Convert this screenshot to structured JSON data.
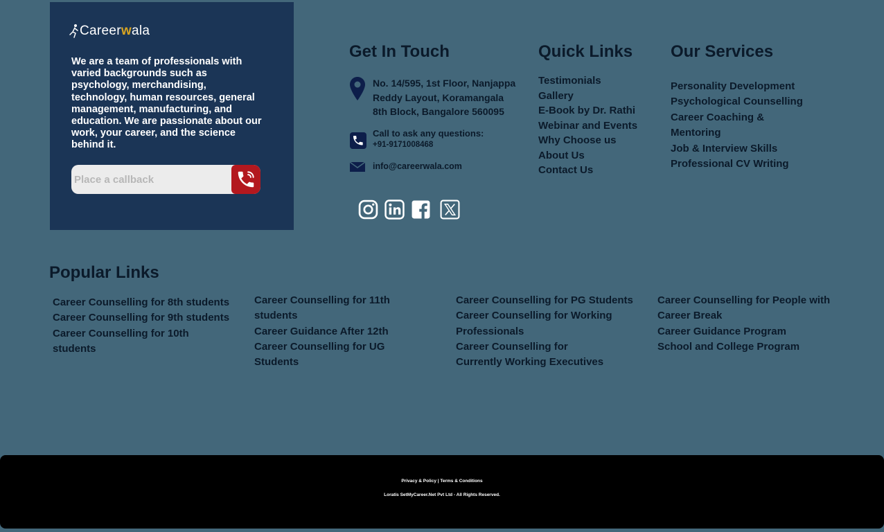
{
  "brand": {
    "logo_main": "Career",
    "logo_w": "w",
    "logo_rest": "ala",
    "accent_color": "#d9a521"
  },
  "about": {
    "text": "We are a team of professionals with varied backgrounds such as psychology, merchandising, technology, human resources, general management, manufacturing, and education. We are passionate about our work, your career, and the science behind it."
  },
  "callback": {
    "placeholder": "Place a callback",
    "button_icon": "phone-icon",
    "button_color": "#b3181e"
  },
  "contact": {
    "heading": "Get In Touch",
    "address": "No. 14/595, 1st Floor, Nanjappa Reddy Layout, Koramangala 8th Block, Bangalore 560095",
    "phone_label": "Call to ask any questions:",
    "phone_number": "+91-9171008468",
    "email": "info@careerwala.com",
    "icons": [
      "location-pin-icon",
      "phone-icon",
      "mail-icon"
    ]
  },
  "socials": [
    "instagram-icon",
    "linkedin-icon",
    "facebook-icon",
    "x-twitter-icon"
  ],
  "quick_links": {
    "heading": "Quick Links",
    "items": [
      "Testimonials",
      "Gallery",
      "E-Book by Dr. Rathi",
      "Webinar and Events",
      "Why Choose us",
      "About Us",
      "Contact Us"
    ]
  },
  "services": {
    "heading": "Our Services",
    "items": [
      "Personality Development",
      "Psychological Counselling",
      "Career Coaching & Mentoring",
      "Job & Interview Skills",
      "Professional CV Writing"
    ]
  },
  "popular": {
    "heading": "Popular Links",
    "col1": [
      "Career Counselling for 8th students",
      "Career Counselling for 9th students",
      "Career Counselling for 10th students"
    ],
    "col2": [
      "Career Counselling for 11th students",
      "Career Guidance After 12th",
      "Career Counselling for UG Students"
    ],
    "col3": [
      "Career Counselling for PG Students",
      "Career Counselling for Working Professionals",
      "Career Counselling for Currently Working Executives"
    ],
    "col4": [
      "Career Counselling for People with Career Break",
      "Career Guidance Program",
      "School and College Program"
    ]
  },
  "footer": {
    "privacy": "Privacy & Policy",
    "separator": " | ",
    "terms": "Terms & Conditions",
    "copyright": "Loratis SetMyCareer.Net Pvt Ltd - All Rights Reserved."
  },
  "colors": {
    "page_bg": "#43677a",
    "card_bg": "#1b3556",
    "footer_bg": "#000000",
    "text_dark": "#0b1a2a"
  }
}
